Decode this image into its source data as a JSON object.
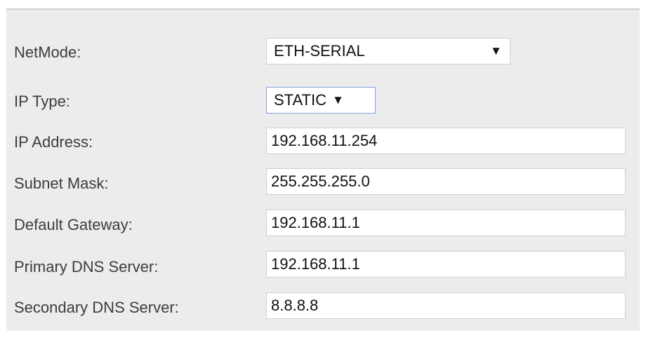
{
  "form": {
    "netmode": {
      "label": "NetMode:",
      "value": "ETH-SERIAL",
      "arrow": "▼"
    },
    "ip_type": {
      "label": "IP Type:",
      "value": "STATIC",
      "arrow": "▼"
    },
    "ip_address": {
      "label": "IP Address:",
      "value": "192.168.11.254"
    },
    "subnet_mask": {
      "label": "Subnet Mask:",
      "value": "255.255.255.0"
    },
    "default_gateway": {
      "label": "Default Gateway:",
      "value": "192.168.11.1"
    },
    "primary_dns": {
      "label": "Primary DNS Server:",
      "value": "192.168.11.1"
    },
    "secondary_dns": {
      "label": "Secondary DNS Server:",
      "value": "8.8.8.8"
    }
  }
}
